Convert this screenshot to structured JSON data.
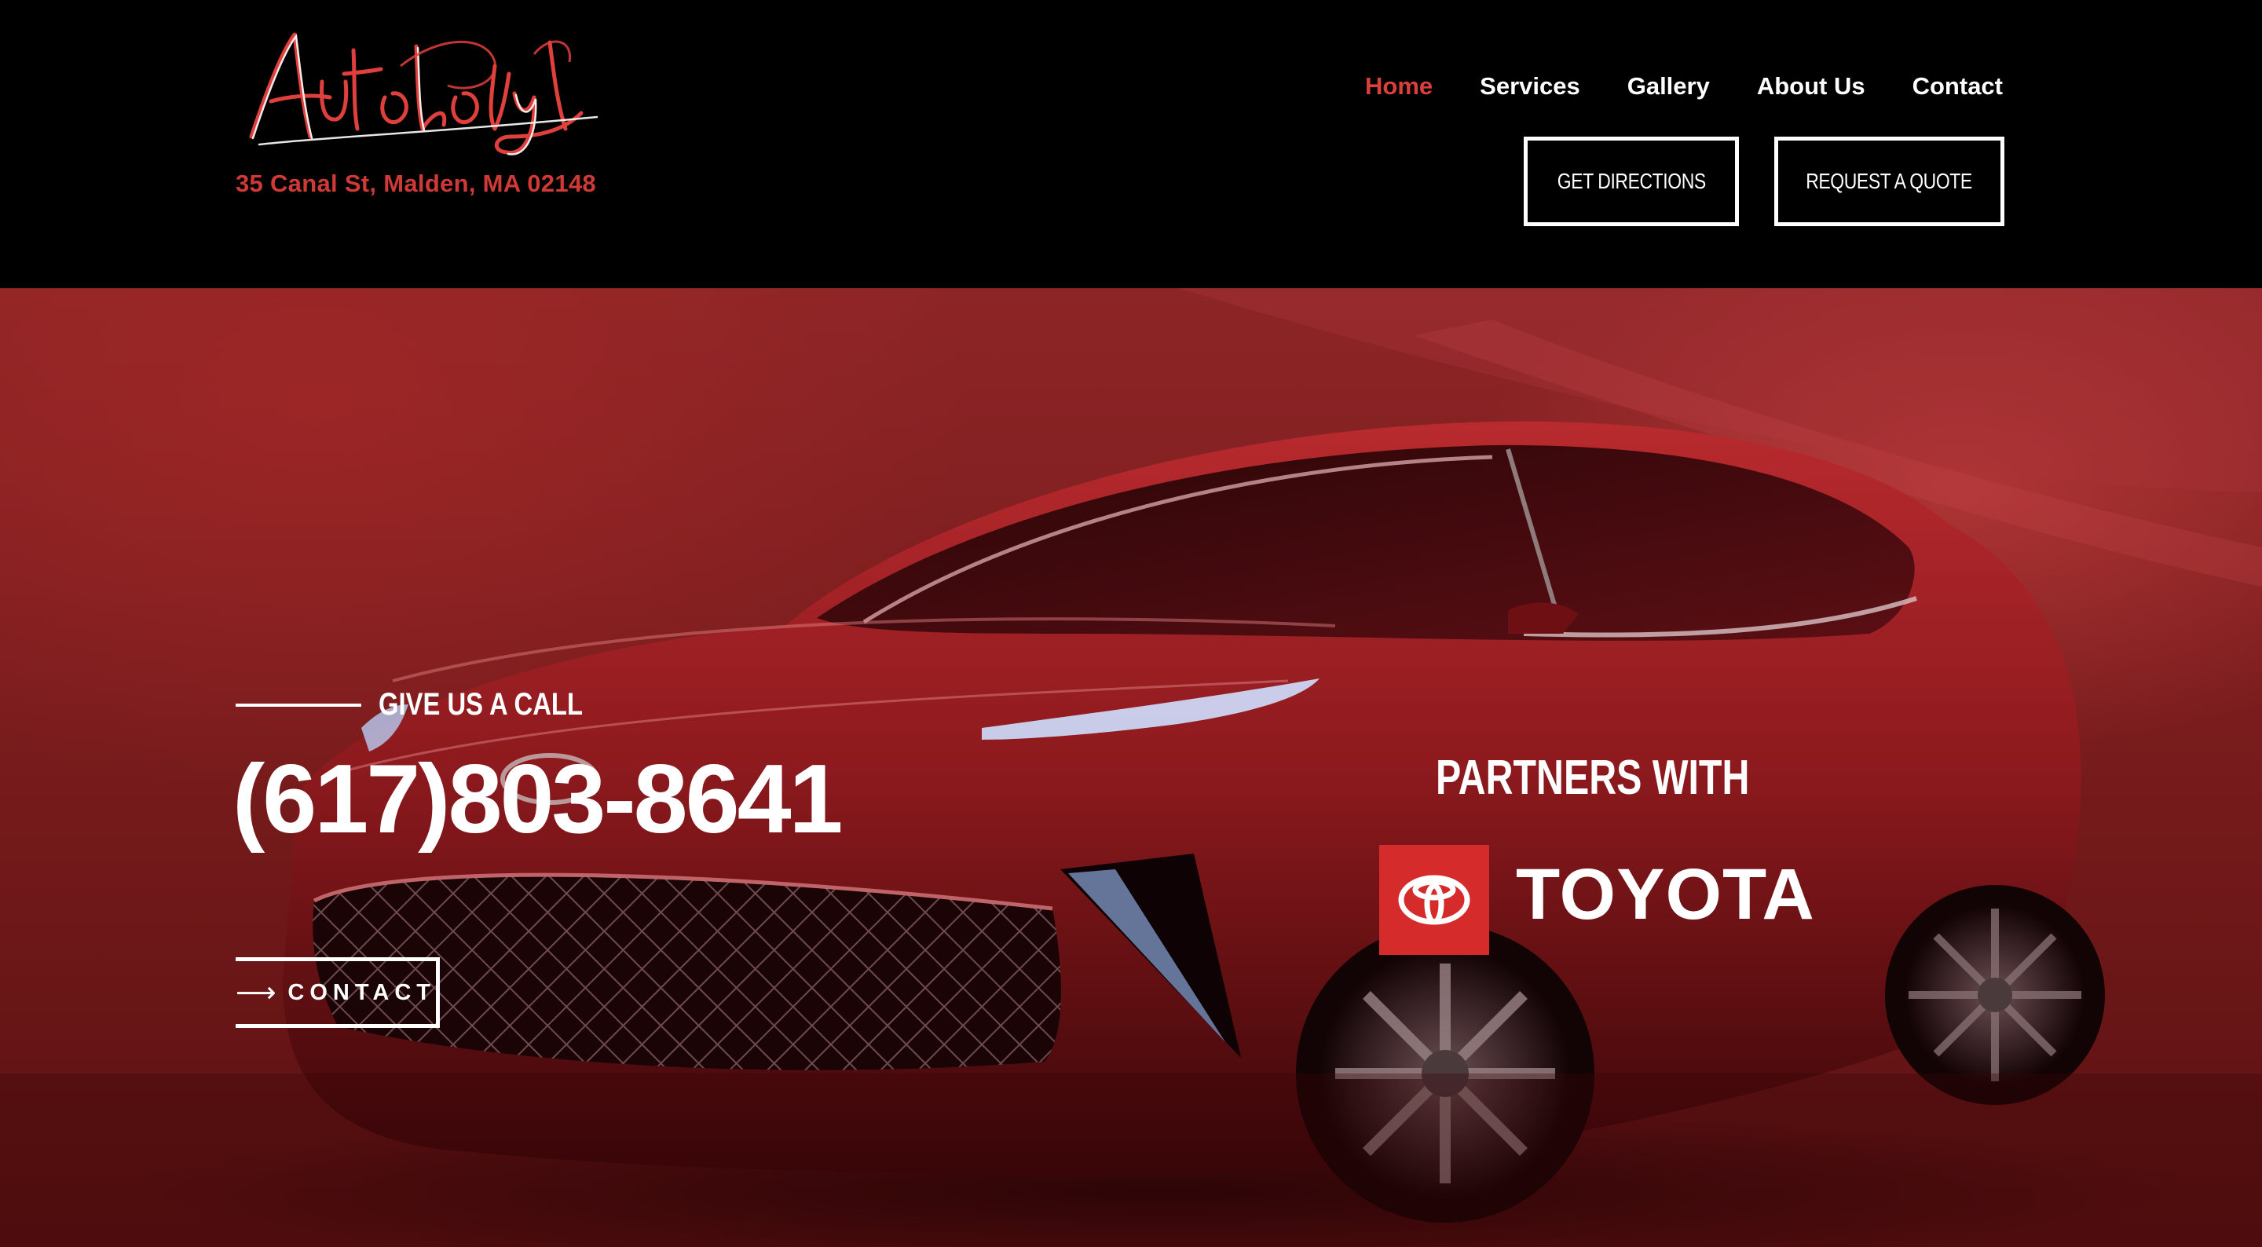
{
  "header": {
    "logo_text": "Autobody Squad",
    "address": "35 Canal St, Malden, MA 02148",
    "nav": [
      {
        "label": "Home",
        "active": true
      },
      {
        "label": "Services",
        "active": false
      },
      {
        "label": "Gallery",
        "active": false
      },
      {
        "label": "About Us",
        "active": false
      },
      {
        "label": "Contact",
        "active": false
      }
    ],
    "get_directions_label": "GET DIRECTIONS",
    "request_quote_label": "REQUEST A QUOTE"
  },
  "hero": {
    "call_label": "GIVE US A CALL",
    "phone": "(617)803-8641",
    "contact_label": "CONTACT",
    "contact_icon": "arrow-right-icon",
    "partners_label": "PARTNERS WITH",
    "partner_name": "TOYOTA",
    "partner_icon": "toyota-logo-icon"
  },
  "colors": {
    "accent_red": "#d9403b",
    "header_bg": "#000000",
    "hero_bg": "#8d2526",
    "toyota_red": "#d52b2b",
    "text_white": "#ffffff"
  }
}
